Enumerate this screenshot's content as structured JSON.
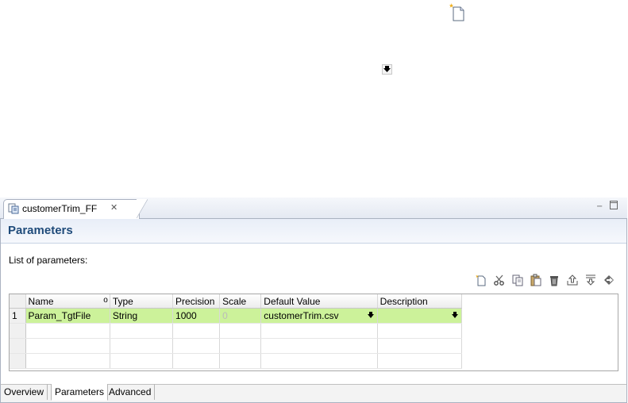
{
  "editor_tab": {
    "title": "customerTrim_FF",
    "close_glyph": "✕"
  },
  "window_controls": {
    "minimize": "−",
    "maximize": "▫"
  },
  "page": {
    "title": "Parameters",
    "section_label": "List of parameters:"
  },
  "toolbar_icons": [
    "new-icon",
    "cut-icon",
    "copy-icon",
    "paste-icon",
    "delete-icon",
    "move-up-icon",
    "move-down-icon",
    "shortcut-icon"
  ],
  "table": {
    "columns": [
      "",
      "Name",
      "Type",
      "Precision",
      "Scale",
      "Default Value",
      "Description"
    ],
    "name_marker": "o",
    "rows": [
      {
        "num": "1",
        "name": "Param_TgtFile",
        "type": "String",
        "precision": "1000",
        "scale": "0",
        "default_value": "customerTrim.csv",
        "description": ""
      }
    ]
  },
  "bottom_tabs": [
    "Overview",
    "Parameters",
    "Advanced"
  ],
  "colors": {
    "selected_row": "#ccf29a",
    "title_text": "#1f4b7a"
  }
}
